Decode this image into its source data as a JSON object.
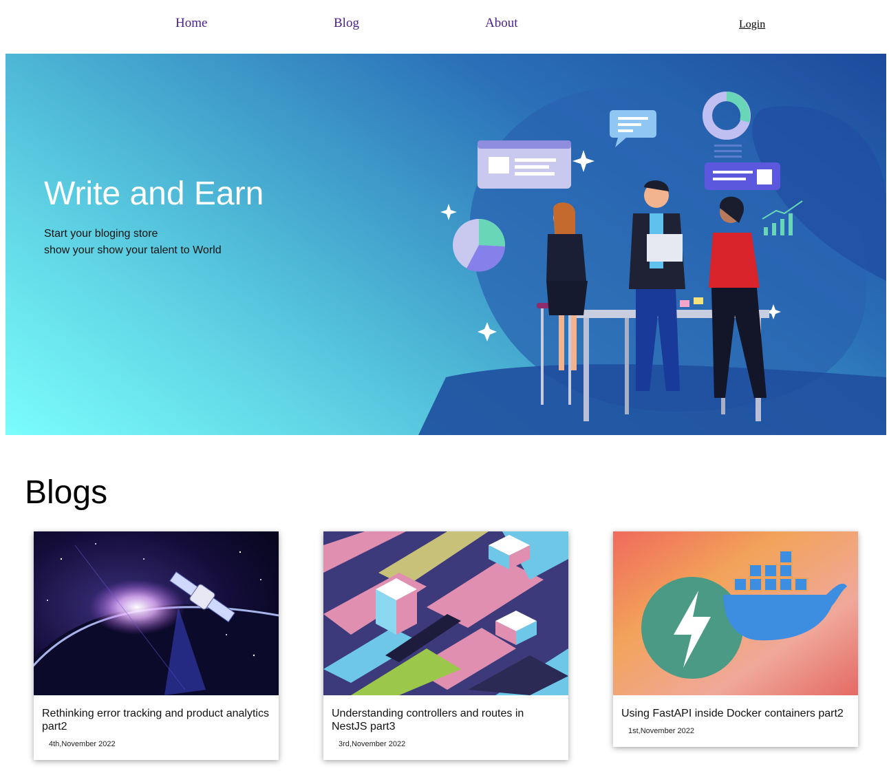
{
  "nav": {
    "home": "Home",
    "blog": "Blog",
    "about": "About",
    "login": "Login"
  },
  "hero": {
    "title": "Write and Earn",
    "subtitle_line1": "Start your bloging store",
    "subtitle_line2": "show your show your talent to World",
    "illustration": "team-collaboration-illustration"
  },
  "blogs": {
    "heading": "Blogs",
    "posts": [
      {
        "title": "Rethinking error tracking and product analytics part2",
        "date": "4th,November 2022",
        "image": "satellite-orbit-image"
      },
      {
        "title": "Understanding controllers and routes in NestJS part3",
        "date": "3rd,November 2022",
        "image": "isometric-blocks-image"
      },
      {
        "title": "Using FastAPI inside Docker containers part2",
        "date": "1st,November 2022",
        "image": "fastapi-docker-logos-image"
      }
    ]
  },
  "colors": {
    "nav_link": "#4a1f8c",
    "hero_light": "#7bfdfb",
    "hero_dark": "#1d4a9c"
  }
}
